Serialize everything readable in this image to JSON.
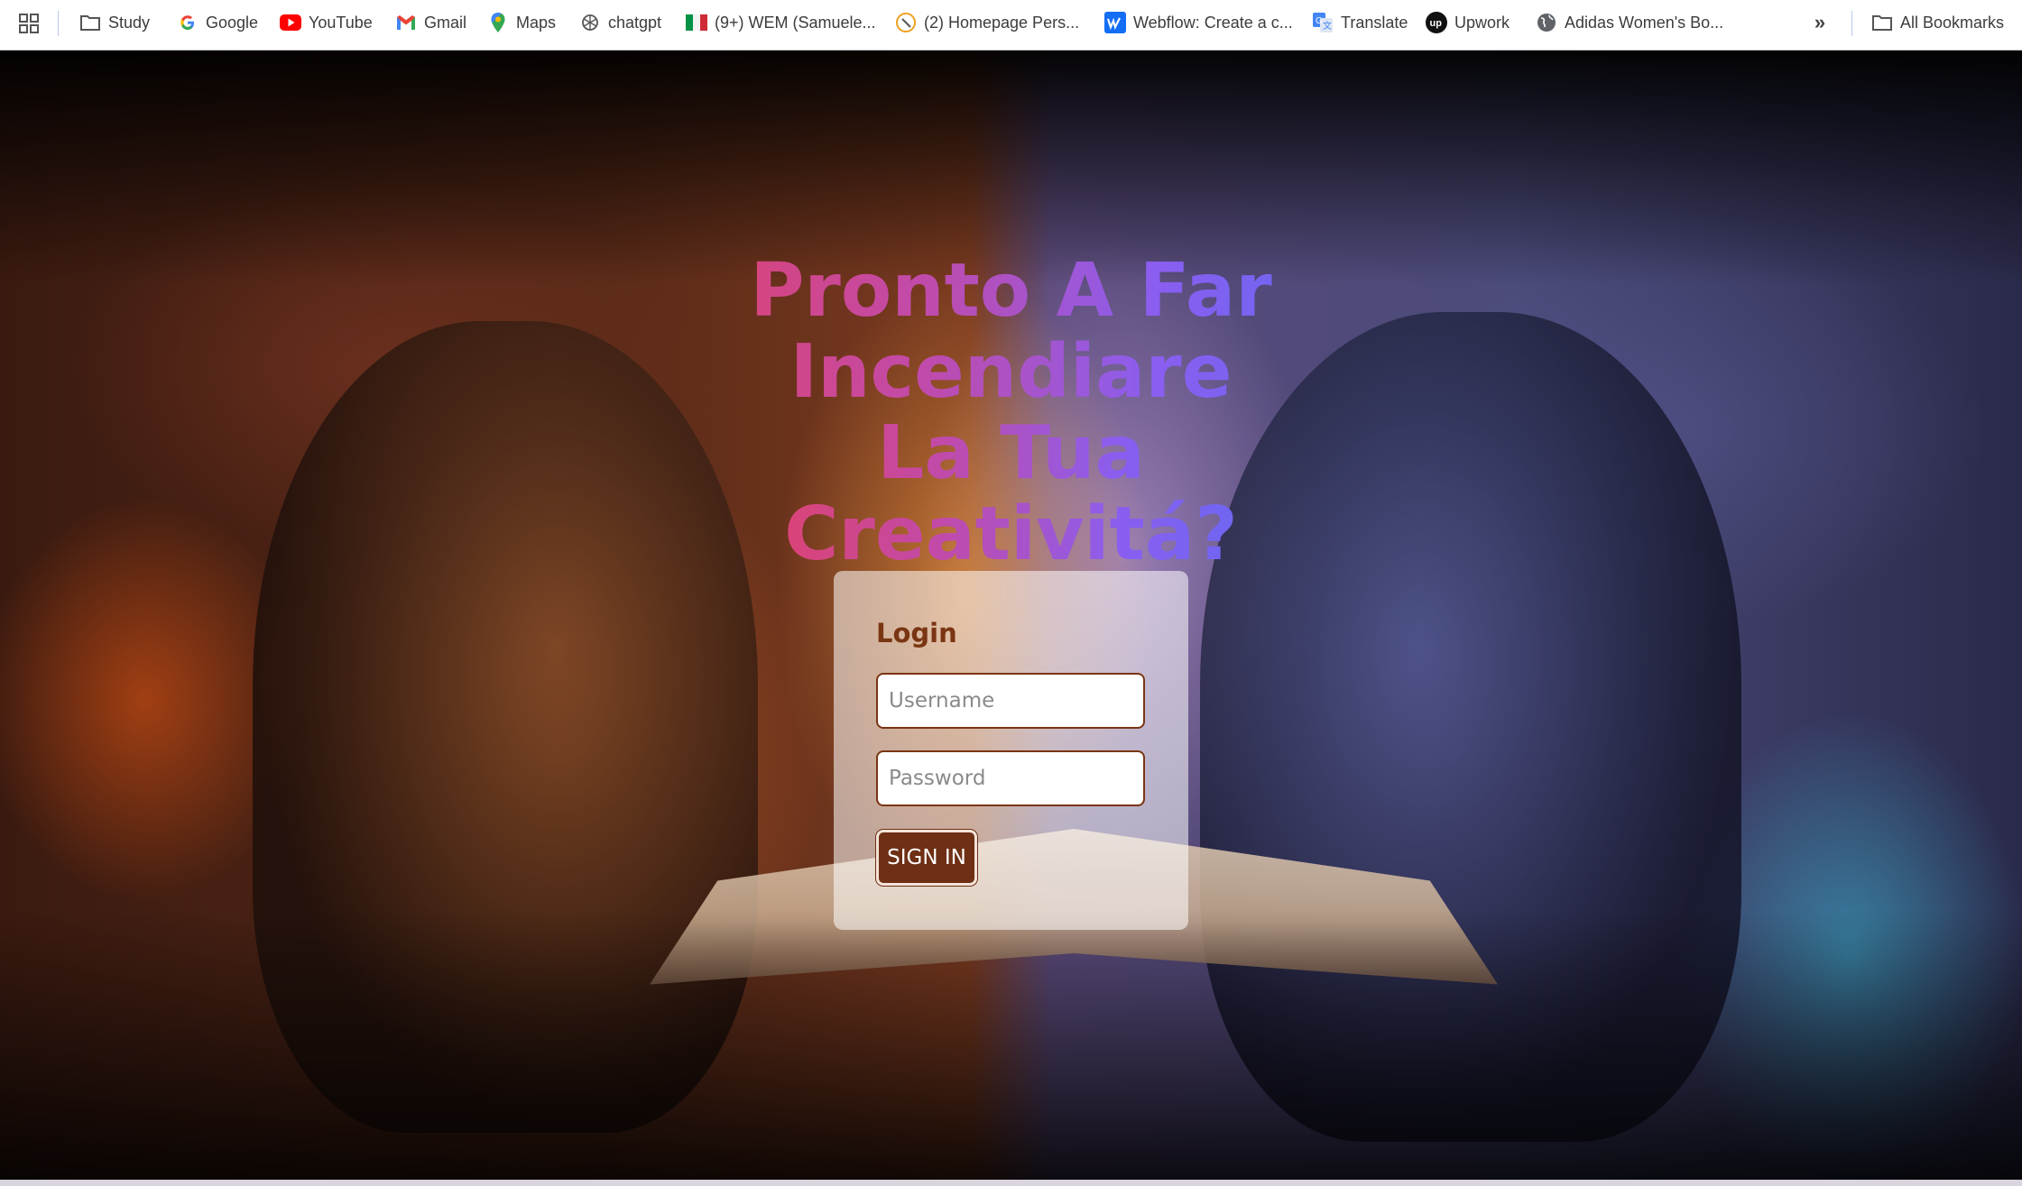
{
  "bookmarks_bar": {
    "apps_icon": "apps-grid-icon",
    "items": [
      {
        "label": "Study",
        "icon": "folder-icon"
      },
      {
        "label": "Google",
        "icon": "google-icon"
      },
      {
        "label": "YouTube",
        "icon": "youtube-icon"
      },
      {
        "label": "Gmail",
        "icon": "gmail-icon"
      },
      {
        "label": "Maps",
        "icon": "maps-pin-icon"
      },
      {
        "label": "chatgpt",
        "icon": "chatgpt-icon"
      },
      {
        "label": "(9+) WEM (Samuele...",
        "icon": "italy-flag-icon"
      },
      {
        "label": "(2) Homepage Pers...",
        "icon": "compass-icon"
      },
      {
        "label": "Webflow: Create a c...",
        "icon": "webflow-icon"
      },
      {
        "label": "Translate",
        "icon": "translate-icon"
      },
      {
        "label": "Upwork",
        "icon": "upwork-icon"
      },
      {
        "label": "Adidas Women's Bo...",
        "icon": "globe-icon"
      }
    ],
    "overflow_label": "»",
    "all_bookmarks": {
      "label": "All Bookmarks",
      "icon": "folder-icon"
    }
  },
  "hero": {
    "headline_line1": "Pronto A Far Incendiare",
    "headline_line2": "La Tua Creativitá?",
    "gradient_colors": [
      "#ee3f4c",
      "#c24aa8",
      "#8a5ef0",
      "#4f6ff3"
    ]
  },
  "login": {
    "title": "Login",
    "username_placeholder": "Username",
    "username_value": "",
    "password_placeholder": "Password",
    "password_value": "",
    "signin_label": "SIGN IN",
    "accent_color": "#6e2f14"
  }
}
